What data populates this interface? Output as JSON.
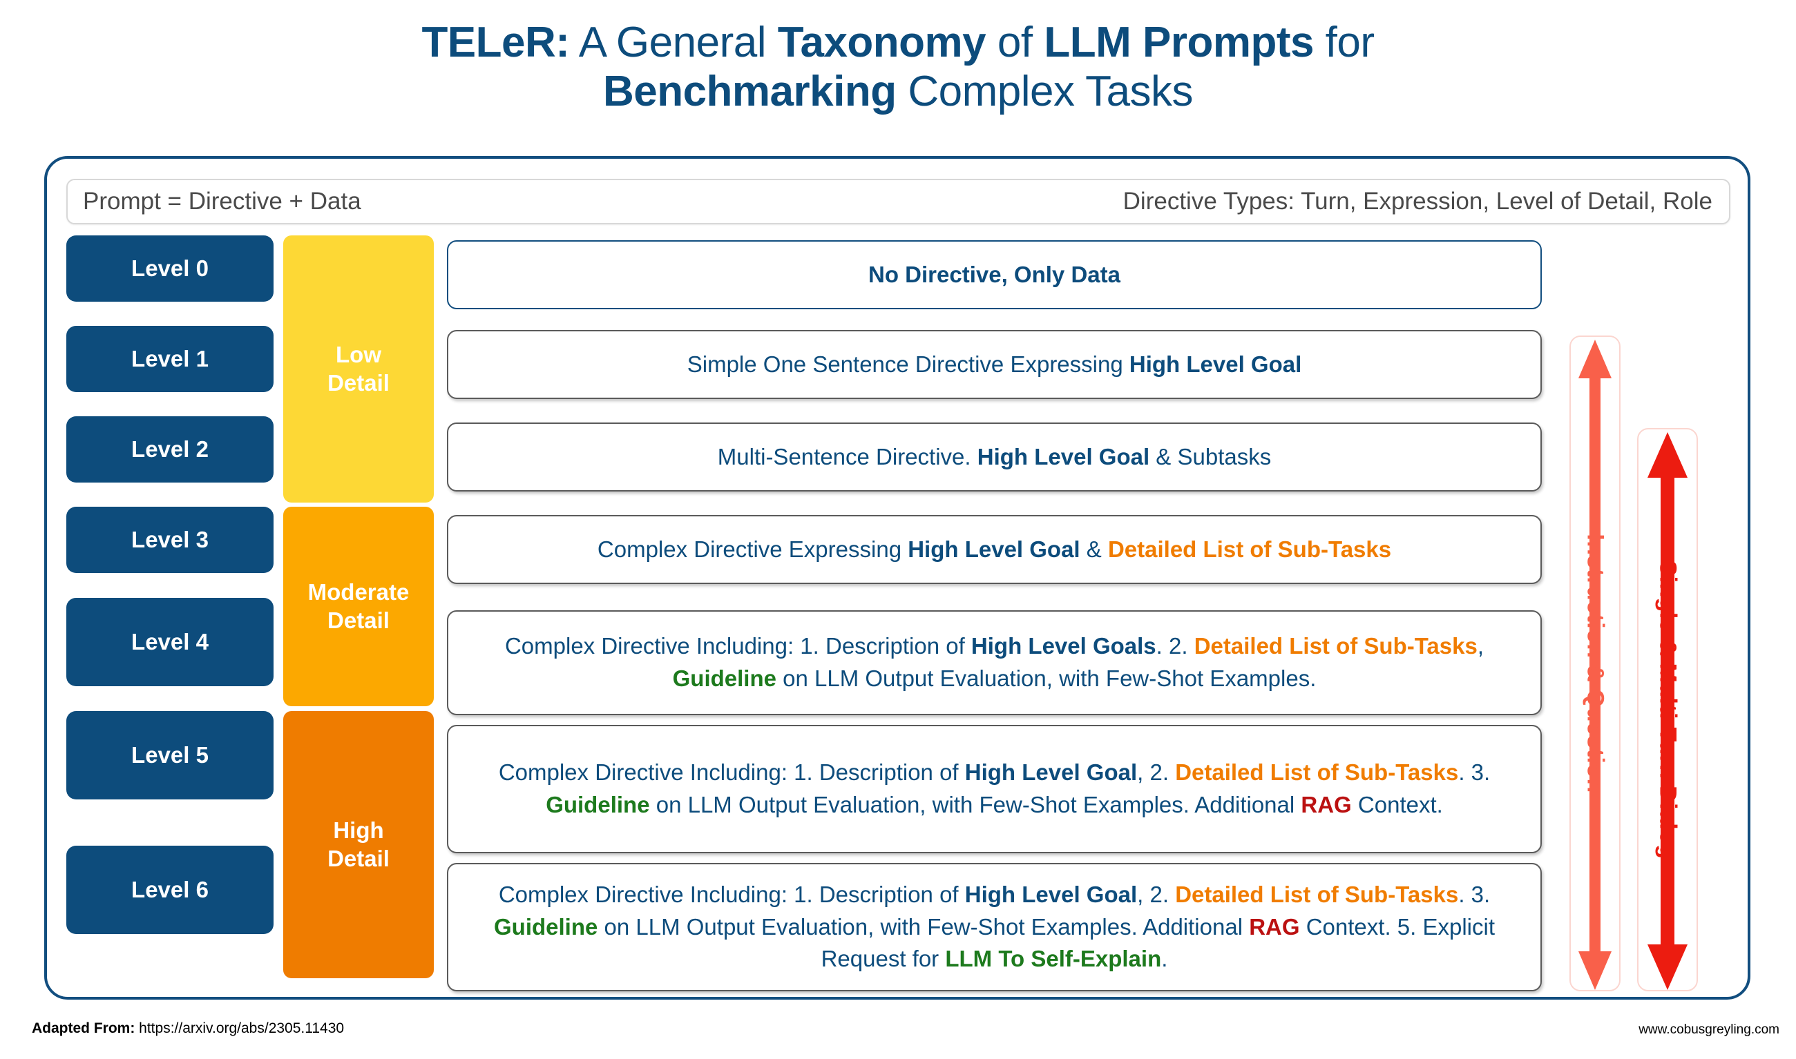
{
  "title": {
    "line1_part1": "TELeR:",
    "line1_part2": " A General ",
    "line1_part3": "Taxonomy",
    "line1_part4": " of ",
    "line1_part5": "LLM Prompts",
    "line1_part6": " for",
    "line2_part1": "Benchmarking",
    "line2_part2": " Complex Tasks"
  },
  "header": {
    "left": "Prompt = Directive + Data",
    "right": "Directive Types: Turn, Expression, Level of Detail, Role"
  },
  "levels": [
    {
      "label": "Level 0"
    },
    {
      "label": "Level 1"
    },
    {
      "label": "Level 2"
    },
    {
      "label": "Level 3"
    },
    {
      "label": "Level 4"
    },
    {
      "label": "Level 5"
    },
    {
      "label": "Level 6"
    }
  ],
  "detail_bands": [
    {
      "name": "low-detail",
      "line1": "Low",
      "line2": "Detail",
      "color": "#fdd835",
      "levels": [
        "Level 0",
        "Level 1",
        "Level 2"
      ]
    },
    {
      "name": "moderate-detail",
      "line1": "Moderate",
      "line2": "Detail",
      "color": "#fca800",
      "levels": [
        "Level 3",
        "Level 4"
      ]
    },
    {
      "name": "high-detail",
      "line1": "High",
      "line2": "Detail",
      "color": "#ef7c00",
      "levels": [
        "Level 5",
        "Level 6"
      ]
    }
  ],
  "descriptions": [
    {
      "level": "Level 0",
      "plain": "No Directive, Only Data"
    },
    {
      "level": "Level 1",
      "plain": "Simple One Sentence Directive Expressing High Level Goal"
    },
    {
      "level": "Level 2",
      "plain": "Multi-Sentence Directive.  High Level Goal & Subtasks"
    },
    {
      "level": "Level 3",
      "plain": "Complex Directive Expressing High Level Goal & Detailed List of Sub-Tasks"
    },
    {
      "level": "Level 4",
      "plain": "Complex Directive Including: 1. Description of High Level Goals. 2. Detailed List of Sub-Tasks, Guideline on LLM Output Evaluation, with Few-Shot Examples."
    },
    {
      "level": "Level 5",
      "plain": "Complex Directive Including: 1. Description of High Level Goal, 2. Detailed List of Sub-Tasks. 3. Guideline on LLM Output Evaluation, with Few-Shot Examples. Additional RAG Context."
    },
    {
      "level": "Level 6",
      "plain": "Complex Directive Including: 1. Description of High Level Goal, 2. Detailed List of Sub-Tasks. 3. Guideline on LLM Output Evaluation, with Few-Shot Examples. Additional RAG Context. 5. Explicit Request for LLM To Self-Explain."
    }
  ],
  "desc_segments": {
    "l0": [
      {
        "t": "No Directive, Only Data",
        "s": "b"
      }
    ],
    "l1": [
      {
        "t": "Simple One Sentence Directive Expressing ",
        "s": "n"
      },
      {
        "t": "High Level Goal",
        "s": "b"
      }
    ],
    "l2": [
      {
        "t": "Multi-Sentence Directive.  ",
        "s": "n"
      },
      {
        "t": "High Level Goal",
        "s": "b"
      },
      {
        "t": " & Subtasks",
        "s": "n"
      }
    ],
    "l3": [
      {
        "t": "Complex Directive Expressing ",
        "s": "n"
      },
      {
        "t": "High Level Goal",
        "s": "b"
      },
      {
        "t": " & ",
        "s": "n"
      },
      {
        "t": "Detailed List of Sub-Tasks",
        "s": "org"
      }
    ],
    "l4": [
      {
        "t": "Complex Directive Including: 1. Description of ",
        "s": "n"
      },
      {
        "t": "High Level Goals",
        "s": "b"
      },
      {
        "t": ". 2. ",
        "s": "n"
      },
      {
        "t": "Detailed List of Sub-Tasks",
        "s": "org"
      },
      {
        "t": ", ",
        "s": "n"
      },
      {
        "t": "Guideline",
        "s": "grn"
      },
      {
        "t": " on LLM Output Evaluation, with Few-Shot Examples.",
        "s": "n"
      }
    ],
    "l5": [
      {
        "t": "Complex Directive Including: 1. Description of ",
        "s": "n"
      },
      {
        "t": "High Level Goal",
        "s": "b"
      },
      {
        "t": ", 2. ",
        "s": "n"
      },
      {
        "t": "Detailed List of Sub-Tasks",
        "s": "org"
      },
      {
        "t": ". 3. ",
        "s": "n"
      },
      {
        "t": "Guideline",
        "s": "grn"
      },
      {
        "t": " on LLM Output Evaluation, with Few-Shot Examples. Additional ",
        "s": "n"
      },
      {
        "t": "RAG",
        "s": "red"
      },
      {
        "t": " Context.",
        "s": "n"
      }
    ],
    "l6": [
      {
        "t": "Complex Directive Including: 1. Description of ",
        "s": "n"
      },
      {
        "t": "High Level Goal",
        "s": "b"
      },
      {
        "t": ", 2. ",
        "s": "n"
      },
      {
        "t": "Detailed List of Sub-Tasks",
        "s": "org"
      },
      {
        "t": ". 3. ",
        "s": "n"
      },
      {
        "t": "Guideline",
        "s": "grn"
      },
      {
        "t": " on LLM Output Evaluation, with Few-Shot Examples. Additional ",
        "s": "n"
      },
      {
        "t": "RAG",
        "s": "red"
      },
      {
        "t": " Context. 5. Explicit Request for ",
        "s": "n"
      },
      {
        "t": "LLM To Self-Explain",
        "s": "grn"
      },
      {
        "t": ".",
        "s": "n"
      }
    ]
  },
  "arrows": [
    {
      "name": "instruction-question-arrow",
      "label": "Instruction & Question",
      "color": "#f9604a",
      "direction": "double"
    },
    {
      "name": "single-multi-turn-dialog-arrow",
      "label": "Single & Multi-Turn Dialog",
      "color": "#ec1c10",
      "direction": "double"
    }
  ],
  "footer": {
    "adapted_label": "Adapted From:",
    "adapted_url": "https://arxiv.org/abs/2305.11430",
    "site": "www.cobusgreyling.com"
  },
  "colors": {
    "brand_blue": "#0d4c7c",
    "low_yellow": "#fdd835",
    "moderate_orange": "#fca800",
    "high_orange": "#ef7c00",
    "accent_orange_text": "#f07c00",
    "accent_green_text": "#1d7a1d",
    "accent_red_text": "#bb1111"
  }
}
